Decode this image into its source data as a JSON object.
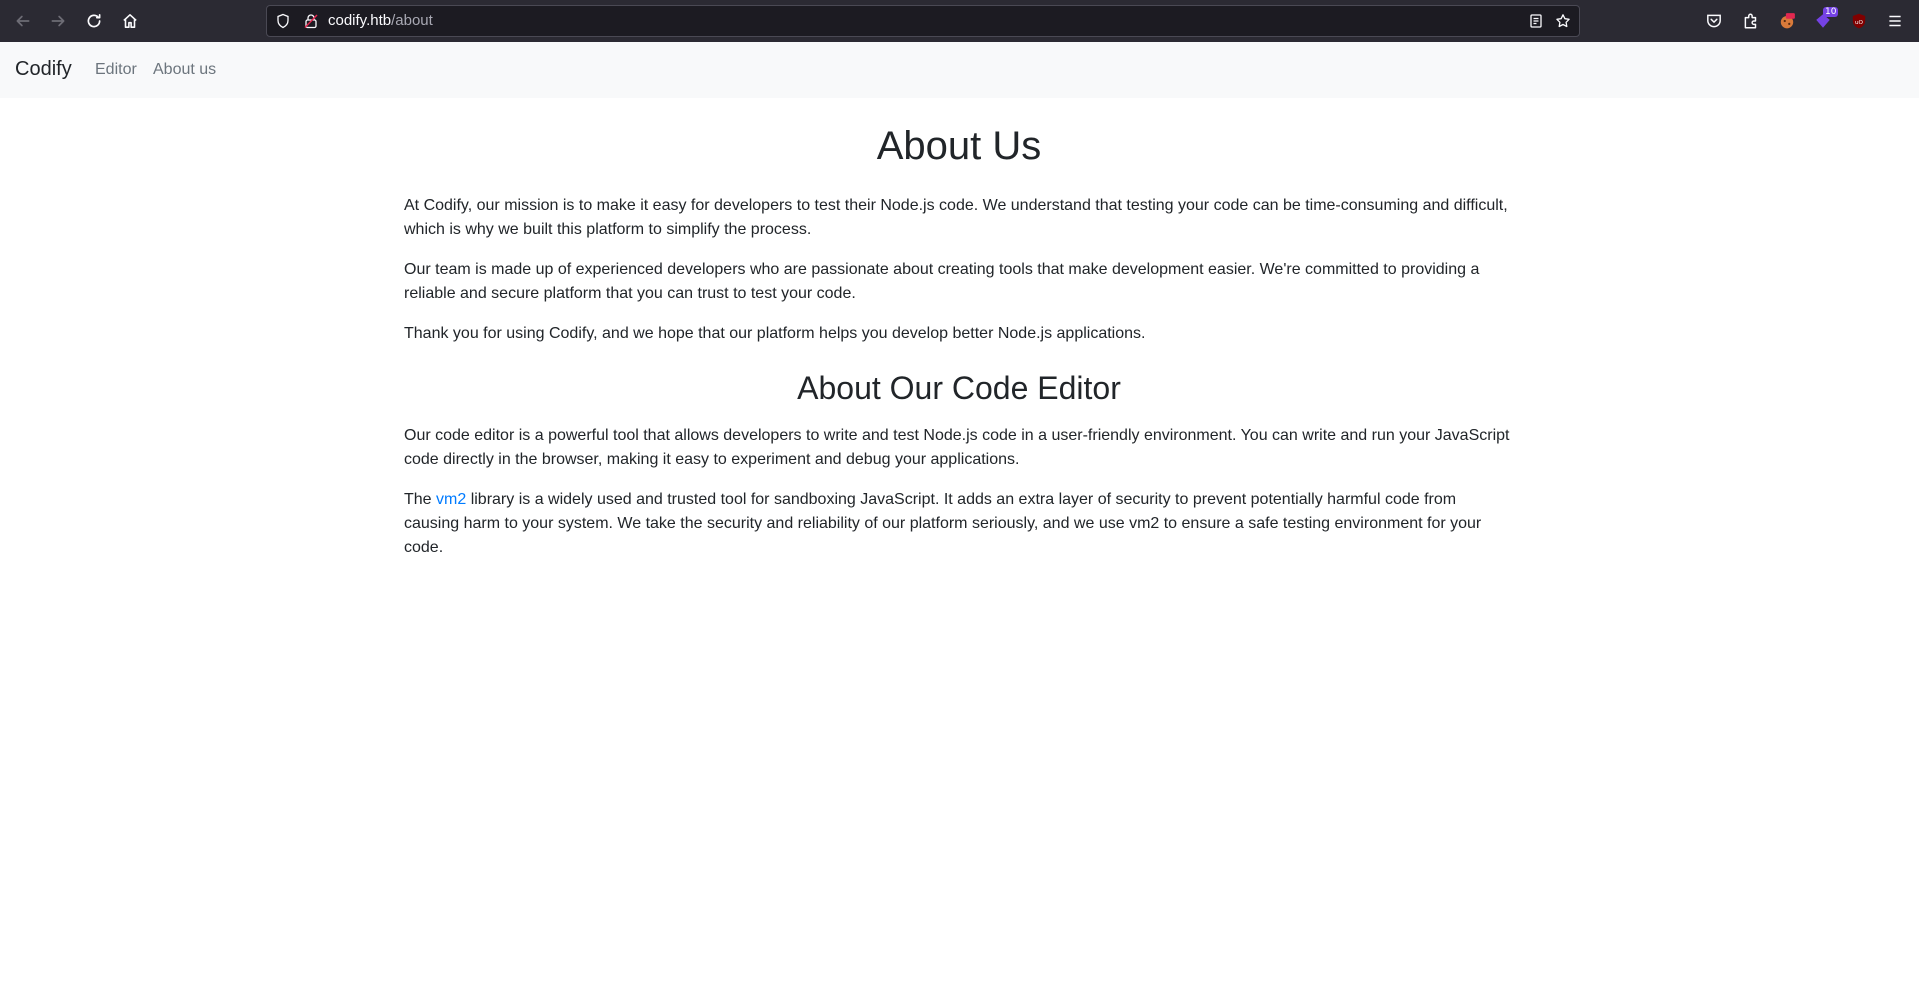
{
  "browser": {
    "url_host": "codify.htb",
    "url_path": "/about",
    "extension_badge_count": "10"
  },
  "navbar": {
    "brand": "Codify",
    "links": [
      {
        "label": "Editor"
      },
      {
        "label": "About us"
      }
    ]
  },
  "page": {
    "title": "About Us",
    "intro_paragraphs": [
      "At Codify, our mission is to make it easy for developers to test their Node.js code. We understand that testing your code can be time-consuming and difficult, which is why we built this platform to simplify the process.",
      "Our team is made up of experienced developers who are passionate about creating tools that make development easier. We're committed to providing a reliable and secure platform that you can trust to test your code.",
      "Thank you for using Codify, and we hope that our platform helps you develop better Node.js applications."
    ],
    "editor_section": {
      "title": "About Our Code Editor",
      "paragraph1": "Our code editor is a powerful tool that allows developers to write and test Node.js code in a user-friendly environment. You can write and run your JavaScript code directly in the browser, making it easy to experiment and debug your applications.",
      "paragraph2_prefix": "The ",
      "paragraph2_link": "vm2",
      "paragraph2_suffix": " library is a widely used and trusted tool for sandboxing JavaScript. It adds an extra layer of security to prevent potentially harmful code from causing harm to your system. We take the security and reliability of our platform seriously, and we use vm2 to ensure a safe testing environment for your code."
    }
  },
  "colors": {
    "browser_chrome": "#2b2a33",
    "navbar_bg": "#f8f9fa",
    "text": "#212529",
    "muted_link": "#6c757d",
    "link": "#007bff"
  }
}
